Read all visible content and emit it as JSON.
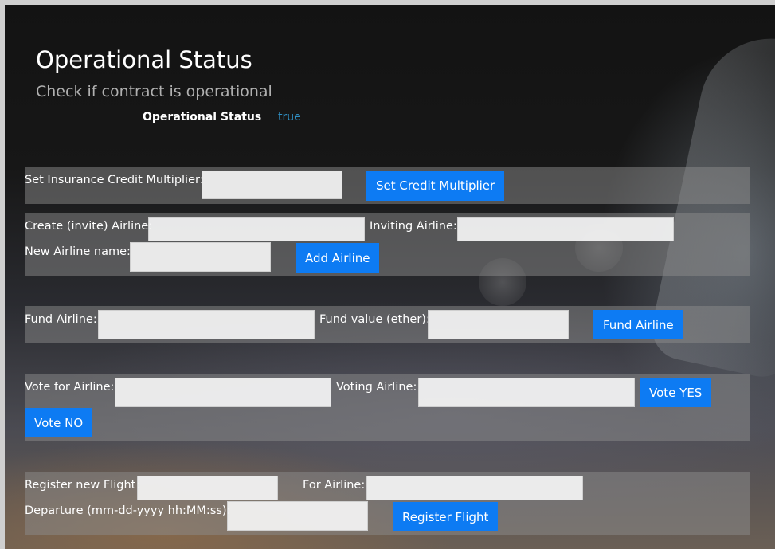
{
  "header": {
    "title": "Operational Status",
    "subtitle": "Check if contract is operational",
    "status_label": "Operational Status",
    "status_value": "true"
  },
  "multiplier": {
    "label": "Set Insurance Credit Multiplier:",
    "input_value": "",
    "button": "Set Credit Multiplier"
  },
  "create_airline": {
    "label": "Create (invite) Airline:",
    "input_value": "",
    "inviting_label": "Inviting Airline:",
    "inviting_value": "",
    "name_label": "New Airline name:",
    "name_value": "",
    "button": "Add Airline"
  },
  "fund_airline": {
    "label": "Fund Airline:",
    "input_value": "",
    "value_label": "Fund value (ether):",
    "value_value": "",
    "button": "Fund Airline"
  },
  "vote": {
    "label": "Vote for Airline:",
    "input_value": "",
    "voting_label": "Voting Airline:",
    "voting_value": "",
    "yes_button": "Vote YES",
    "no_button": "Vote NO"
  },
  "register_flight": {
    "label": "Register new Flight:",
    "input_value": "",
    "airline_label": "For Airline:",
    "airline_value": "",
    "departure_label": "Departure (mm-dd-yyyy hh:MM:ss):",
    "departure_value": "",
    "button": "Register Flight"
  },
  "colors": {
    "button": "#0d7bf3",
    "status_value": "#2f8fc3",
    "panel": "rgba(140,140,140,0.5)"
  }
}
